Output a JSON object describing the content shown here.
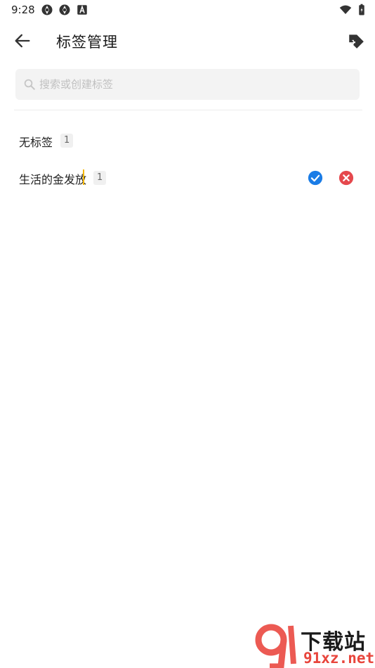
{
  "status_bar": {
    "time": "9:28",
    "icons": [
      "aperture-icon",
      "aperture-icon",
      "font-a-icon",
      "wifi-icon",
      "battery-icon"
    ]
  },
  "app_bar": {
    "title": "标签管理",
    "back_icon": "arrow-left-icon",
    "action_icon": "tag-add-icon"
  },
  "search": {
    "placeholder": "搜索或创建标签",
    "value": ""
  },
  "tags": [
    {
      "name": "无标签",
      "count": "1"
    },
    {
      "name": "生活的金发放",
      "count": "1",
      "editing": true
    }
  ],
  "colors": {
    "confirm": "#1a7ce6",
    "cancel": "#e5484d",
    "caret": "#f5b800",
    "search_bg": "#f3f3f3"
  },
  "watermark": {
    "text": "下载站",
    "domain": "91xz.net"
  }
}
